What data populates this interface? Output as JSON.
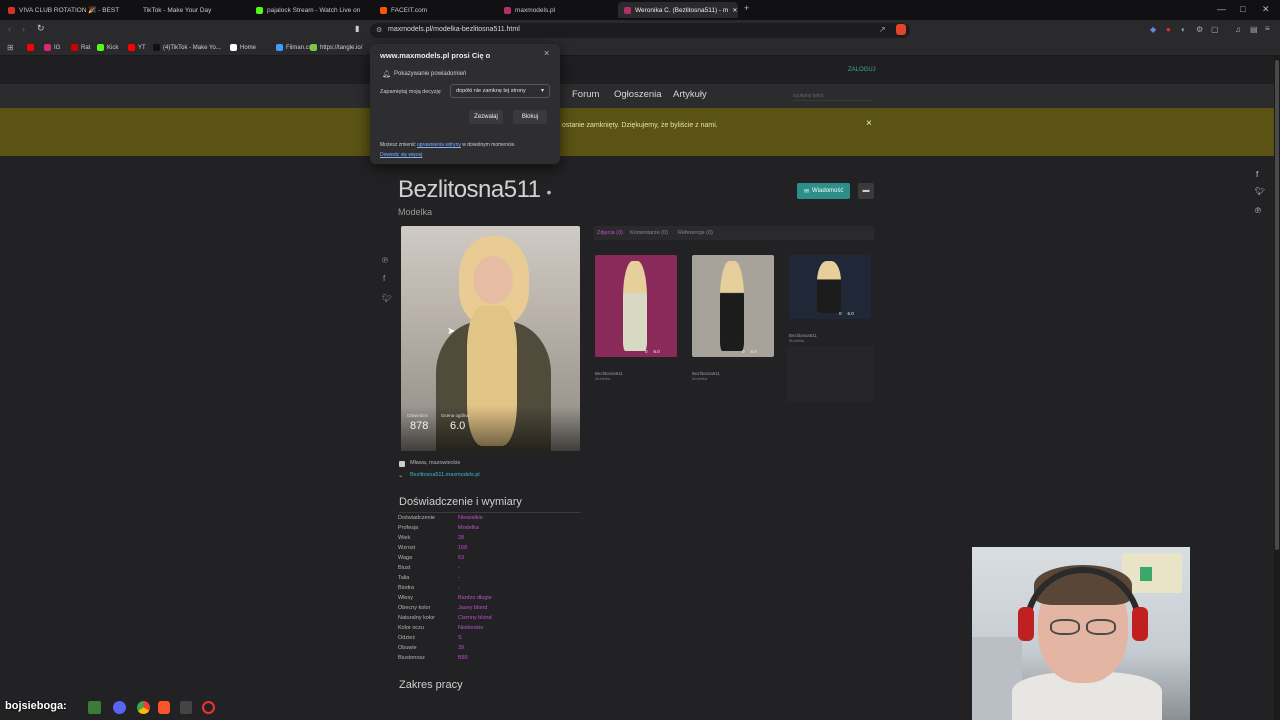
{
  "browser": {
    "tabs": [
      {
        "label": "VIVA CLUB ROTATION 🎉 - BEST !",
        "color": "#d93025"
      },
      {
        "label": "TikTok - Make Your Day",
        "color": "#111111"
      },
      {
        "label": "pajalock Stream - Watch Live on",
        "color": "#53fc18"
      },
      {
        "label": "FACEIT.com",
        "color": "#ff5500"
      },
      {
        "label": "maxmodels.pl",
        "color": "#b0306a"
      },
      {
        "label": "Weronika C. (Bezlitosna511) - m",
        "color": "#b0306a"
      }
    ],
    "new_tab": "+",
    "url": "maxmodels.pl/modelka-bezlitosna511.html",
    "bookmarks": [
      {
        "label": "",
        "color": "#ff0000"
      },
      {
        "label": "IG",
        "color": "#d62976"
      },
      {
        "label": "Rat",
        "color": "#cc0000"
      },
      {
        "label": "Kick",
        "color": "#53fc18"
      },
      {
        "label": "YT",
        "color": "#ff0000"
      },
      {
        "label": "(4)TikTok - Make Yo...",
        "color": "#111111"
      },
      {
        "label": "Home",
        "color": "#ffffff"
      },
      {
        "label": "Filman.cc",
        "color": "#3aa0ff"
      },
      {
        "label": "https://tangle.io/",
        "color": "#7ac943"
      }
    ]
  },
  "permission_popup": {
    "title": "www.maxmodels.pl prosi Cię o",
    "item": "Pokazywanie powiadomień",
    "remember_label": "Zapamiętaj moją decyzję",
    "remember_value": "dopóki nie zamknę tej strony",
    "allow": "Zezwalaj",
    "block": "Blokuj",
    "footer_prefix": "Możesz zmienić",
    "footer_link": "uprawnienia witryny",
    "footer_suffix": "w dowolnym momencie.",
    "learn_more": "Dowiedz się więcej",
    "close": "×"
  },
  "site": {
    "login": "ZALOGUJ",
    "nav": [
      "Forum",
      "Ogłoszenia",
      "Artykuły"
    ],
    "search_placeholder": "szukany tekst",
    "banner_text": "ostanie zamknięty. Dziękujemy, że byliście z nami.",
    "banner_close": "×"
  },
  "profile": {
    "name": "Bezlitosna511",
    "dot": "•",
    "role": "Modelka",
    "message_button": "Wiadomość",
    "views_label": "Odwiedzin",
    "views": "878",
    "rating_label": "Ocena ogólna",
    "rating": "6.0",
    "location": "Mława, mazowieckie",
    "site": "Bezlitosna511.maxmodels.pl",
    "tabs": [
      "Zdjęcia (3)",
      "Komentarze (0)",
      "Referencje (0)"
    ],
    "gallery": [
      {
        "author": "Bezlitosna511",
        "role": "Modelka",
        "comments": "0",
        "score": "6.0",
        "bg": "#8a2a5a"
      },
      {
        "author": "Bezlitosna511",
        "role": "Modelka",
        "comments": "0",
        "score": "6.0",
        "bg": "#a8a39a"
      },
      {
        "author": "Bezlitosna511",
        "role": "Modelka",
        "comments": "0",
        "score": "6.0",
        "bg": "#202838"
      }
    ],
    "experience_title": "Doświadczenie i wymiary",
    "specs": [
      {
        "k": "Doświadczenie",
        "v": "Niewielkie"
      },
      {
        "k": "Profesja",
        "v": "Modelka"
      },
      {
        "k": "Wiek",
        "v": "28"
      },
      {
        "k": "Wzrost",
        "v": "168"
      },
      {
        "k": "Waga",
        "v": "53"
      },
      {
        "k": "Biust",
        "v": "-"
      },
      {
        "k": "Talia",
        "v": "-"
      },
      {
        "k": "Biodra",
        "v": "-"
      },
      {
        "k": "Włosy",
        "v": "Bardzo długie"
      },
      {
        "k": "Obecny kolor",
        "v": "Jasny blond"
      },
      {
        "k": "Naturalny kolor",
        "v": "Ciemny blond"
      },
      {
        "k": "Kolor oczu",
        "v": "Niebieskie"
      },
      {
        "k": "Odzież",
        "v": "S"
      },
      {
        "k": "Obuwie",
        "v": "39"
      },
      {
        "k": "Biustonosz",
        "v": "B85"
      }
    ],
    "scope_title": "Zakres pracy"
  },
  "taskbar": {
    "overlay_text": "bojsieboga:"
  }
}
